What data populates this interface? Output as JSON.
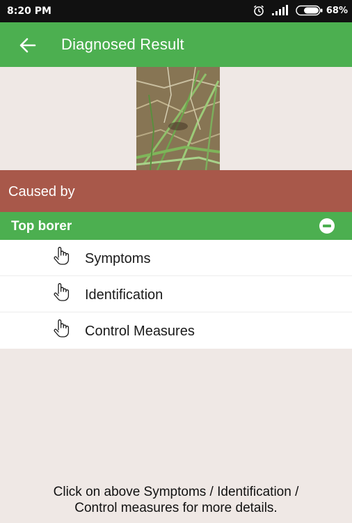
{
  "status_bar": {
    "time": "8:20 PM",
    "battery_pct": "68%",
    "icons": [
      "alarm-icon",
      "signal-icon",
      "battery-icon"
    ]
  },
  "app_bar": {
    "title": "Diagnosed Result",
    "back_icon": "arrow-left-icon"
  },
  "caused_by": {
    "label": "Caused by"
  },
  "group": {
    "title": "Top borer",
    "toggle_icon": "minus-circle-icon",
    "items": [
      {
        "label": "Symptoms",
        "icon": "hand-pointer-icon"
      },
      {
        "label": "Identification",
        "icon": "hand-pointer-icon"
      },
      {
        "label": "Control Measures",
        "icon": "hand-pointer-icon"
      }
    ]
  },
  "footer": {
    "line1": "Click on above Symptoms / Identification /",
    "line2": "Control measures for more details."
  },
  "colors": {
    "app_bar": "#4caf50",
    "caused_bar": "#a8584a",
    "background": "#efe8e5",
    "status_bar": "#111111"
  }
}
